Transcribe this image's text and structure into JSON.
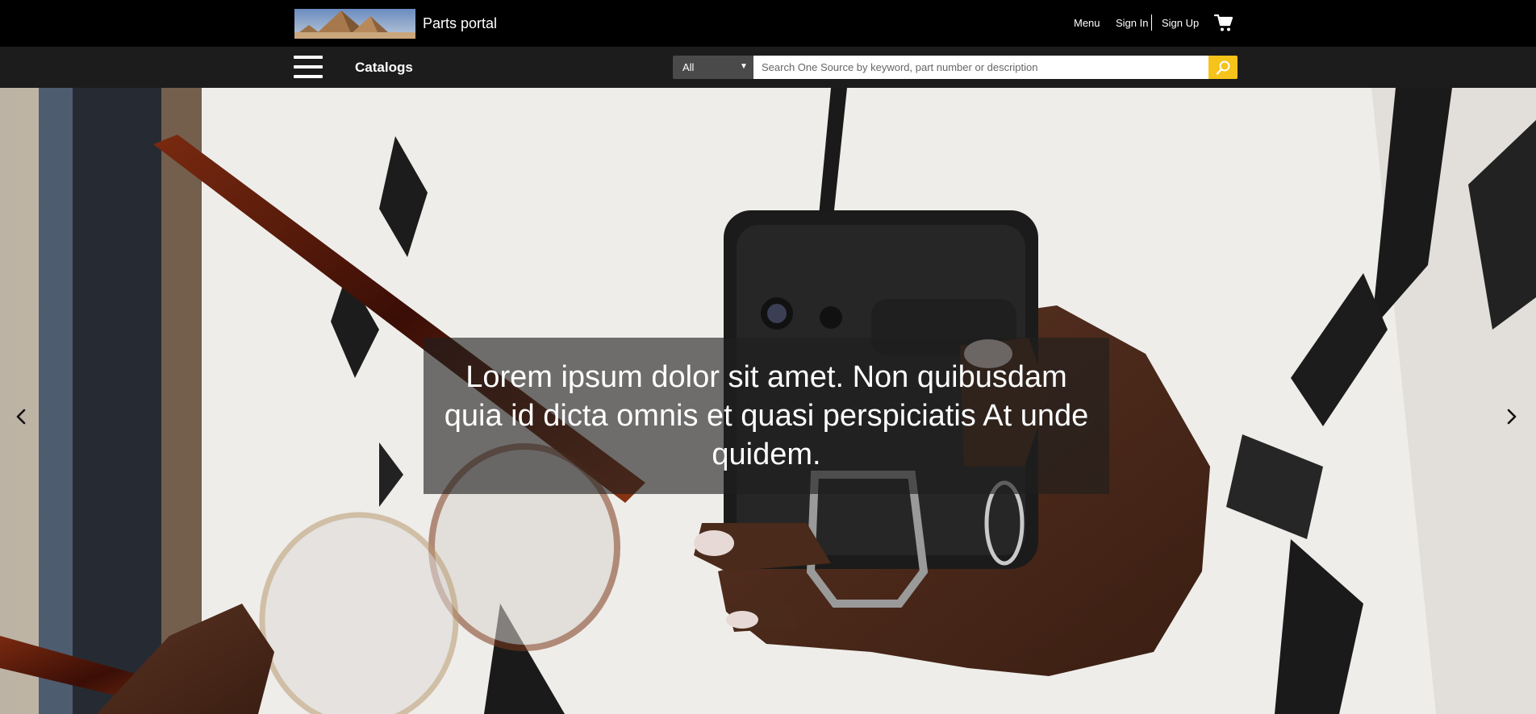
{
  "header": {
    "brand": "Parts portal",
    "nav": {
      "menu": "Menu",
      "sign_in": "Sign In",
      "sign_up": "Sign Up"
    },
    "cart_icon": "shopping-cart-icon"
  },
  "subnav": {
    "catalogs": "Catalogs",
    "menu_icon": "hamburger-menu-icon"
  },
  "search": {
    "scope": "All",
    "placeholder": "Search One Source by keyword, part number or description",
    "button_icon": "search-icon"
  },
  "hero": {
    "caption": "Lorem ipsum dolor sit amet. Non quibusdam quia id dicta omnis et quasi perspiciatis At unde quidem.",
    "prev_icon": "chevron-left-icon",
    "next_icon": "chevron-right-icon"
  },
  "colors": {
    "topbar": "#000000",
    "subbar": "#1c1c1c",
    "search_accent": "#f6c31a",
    "scope_bg": "#4a4a4a"
  }
}
